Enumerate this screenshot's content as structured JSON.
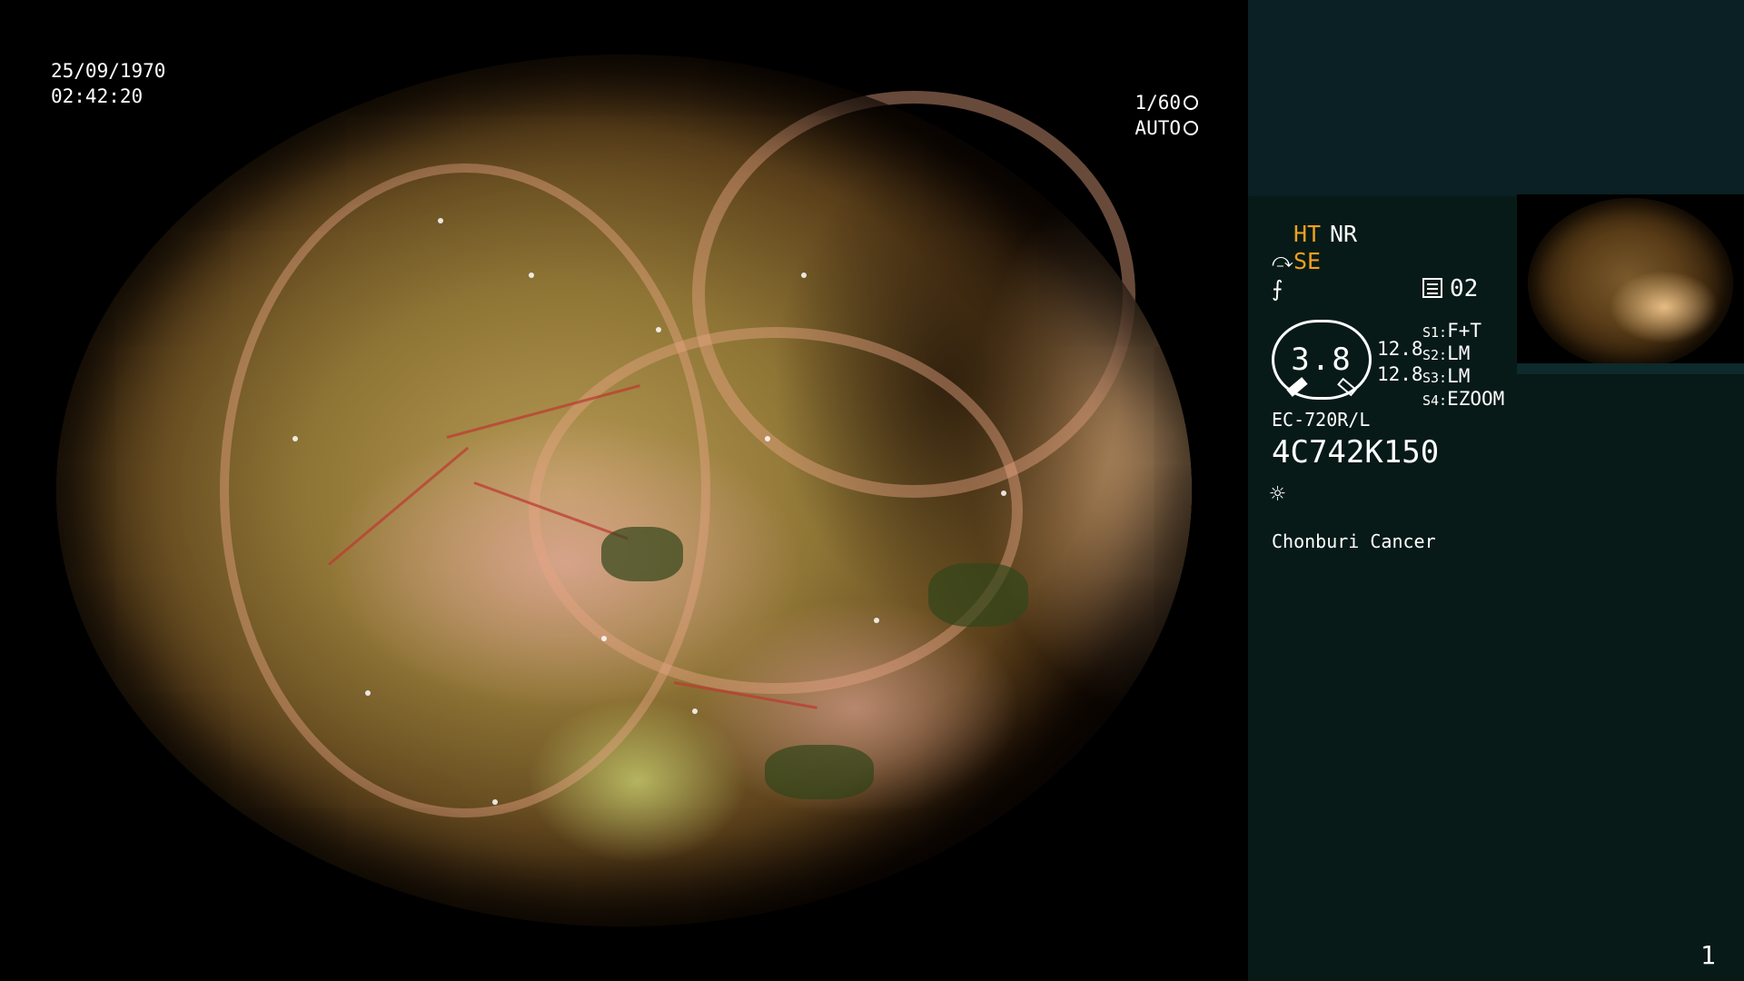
{
  "main_view": {
    "date": "25/09/1970",
    "time": "02:42:20",
    "shutter": "1/60",
    "iris_mode": "AUTO"
  },
  "side_panel": {
    "ht_label": "HT",
    "nr_label": "NR",
    "se_label": "SE",
    "se_icon": "⤼",
    "enhancement_icon": "⨍",
    "memo_number": "02",
    "zoom_value": "3.8",
    "value_a": "12.8",
    "value_b": "12.8",
    "switches": [
      {
        "key": "S1:",
        "value": "F+T"
      },
      {
        "key": "S2:",
        "value": "LM"
      },
      {
        "key": "S3:",
        "value": "LM"
      },
      {
        "key": "S4:",
        "value": "EZOOM"
      }
    ],
    "scope_model": "EC-720R/L",
    "serial_number": "4C742K150",
    "light_icon": "☼",
    "institution": "Chonburi Cancer",
    "page_number": "1"
  },
  "colors": {
    "accent_orange": "#f0a020",
    "panel_background": "#071a17",
    "panel_top_band": "#0b2024"
  }
}
